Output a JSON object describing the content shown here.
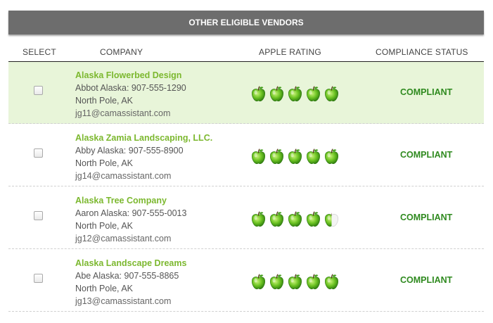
{
  "title": "OTHER ELIGIBLE VENDORS",
  "columns": {
    "select": "SELECT",
    "company": "COMPANY",
    "rating": "APPLE RATING",
    "status": "COMPLIANCE STATUS"
  },
  "colors": {
    "accent": "#7cb82f",
    "status": "#2f8a1f",
    "highlight": "#e8f5d9",
    "header": "#6d6d6d"
  },
  "vendors": [
    {
      "name": "Alaska Flowerbed Design",
      "contact": "Abbot Alaska: 907-555-1290",
      "location": "North Pole, AK",
      "email": "jg11@camassistant.com",
      "rating": 5,
      "status": "COMPLIANT"
    },
    {
      "name": "Alaska Zamia Landscaping, LLC.",
      "contact": "Abby Alaska: 907-555-8900",
      "location": "North Pole, AK",
      "email": "jg14@camassistant.com",
      "rating": 5,
      "status": "COMPLIANT"
    },
    {
      "name": "Alaska Tree Company",
      "contact": "Aaron Alaska: 907-555-0013",
      "location": "North Pole, AK",
      "email": "jg12@camassistant.com",
      "rating": 4.5,
      "status": "COMPLIANT"
    },
    {
      "name": "Alaska Landscape Dreams",
      "contact": "Abe Alaska: 907-555-8865",
      "location": "North Pole, AK",
      "email": "jg13@camassistant.com",
      "rating": 5,
      "status": "COMPLIANT"
    }
  ]
}
